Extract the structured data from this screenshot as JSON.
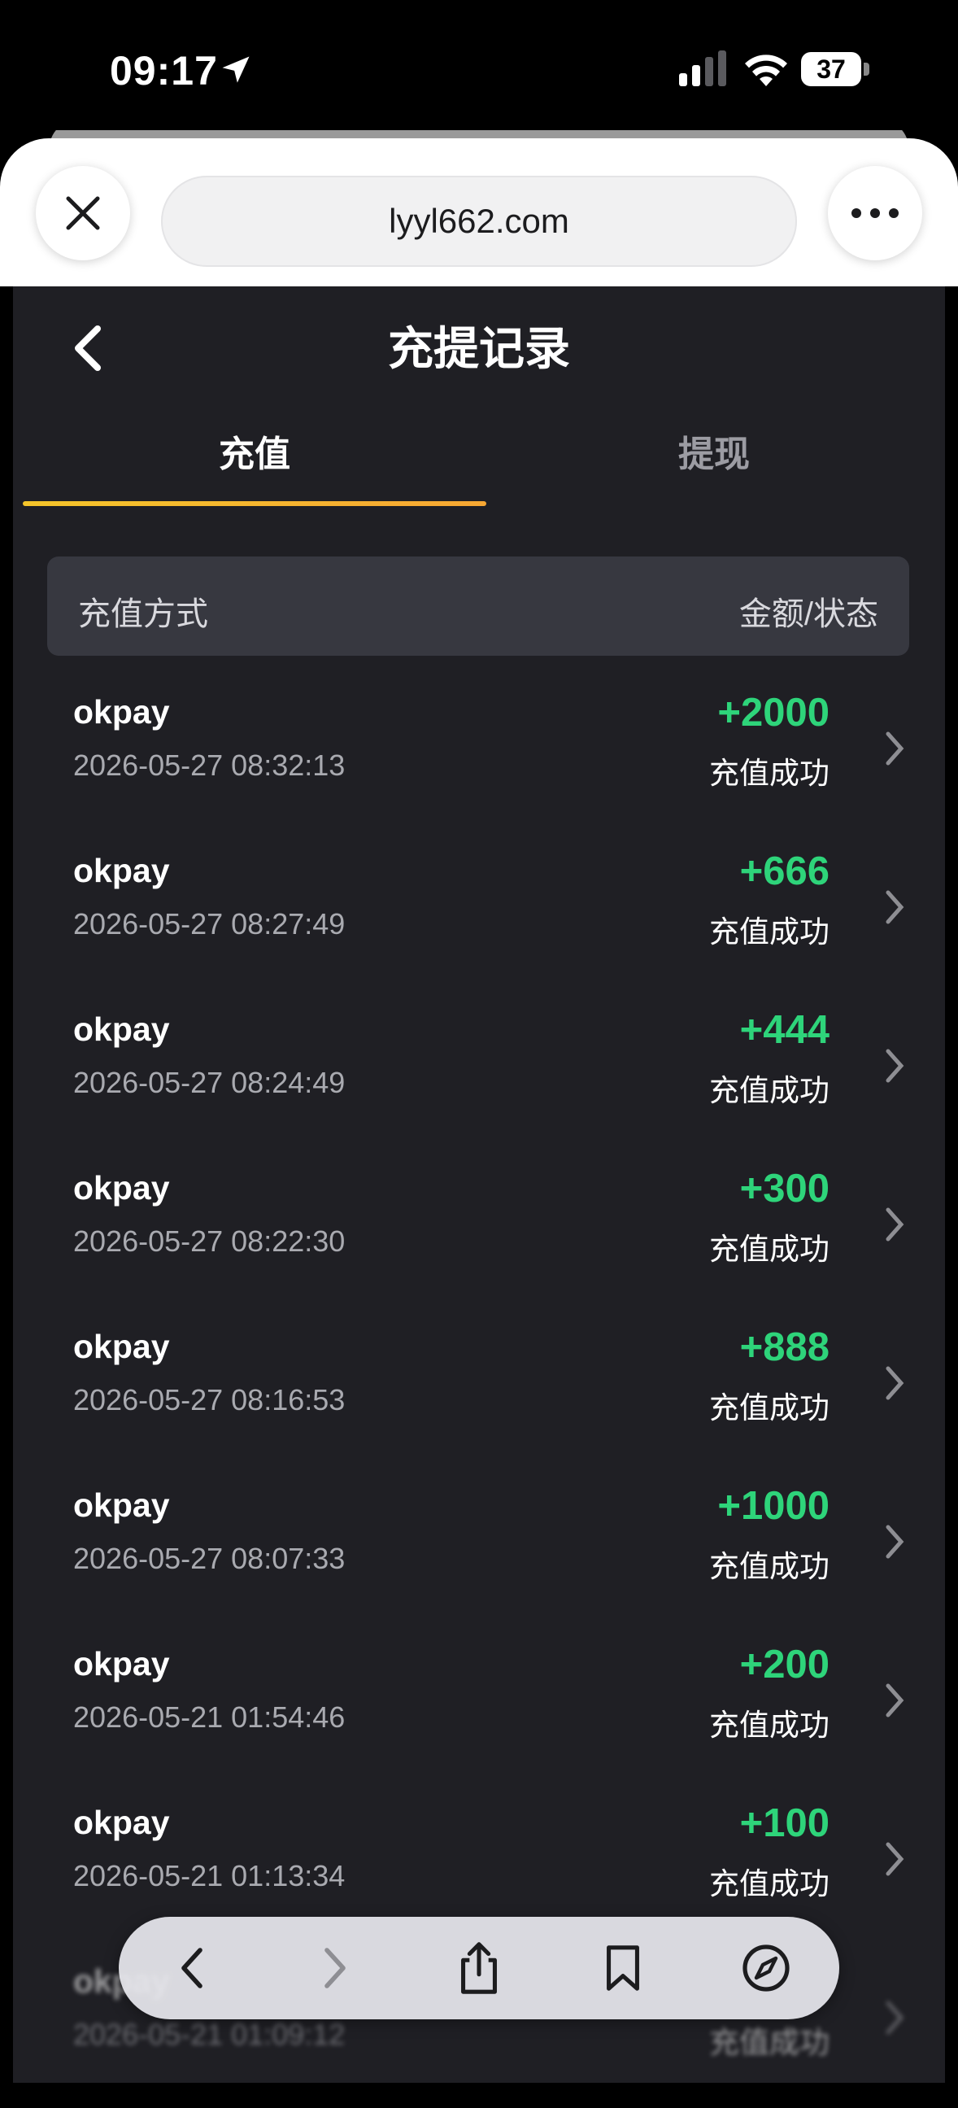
{
  "status_bar": {
    "time": "09:17",
    "battery": "37"
  },
  "browser": {
    "url": "lyyl662.com"
  },
  "page": {
    "title": "充提记录"
  },
  "tabs": [
    {
      "label": "充值",
      "active": true
    },
    {
      "label": "提现",
      "active": false
    }
  ],
  "list_header": {
    "left": "充值方式",
    "right": "金额/状态"
  },
  "records": [
    {
      "method": "okpay",
      "date": "2026-05-27 08:32:13",
      "amount": "+2000",
      "status": "充值成功"
    },
    {
      "method": "okpay",
      "date": "2026-05-27 08:27:49",
      "amount": "+666",
      "status": "充值成功"
    },
    {
      "method": "okpay",
      "date": "2026-05-27 08:24:49",
      "amount": "+444",
      "status": "充值成功"
    },
    {
      "method": "okpay",
      "date": "2026-05-27 08:22:30",
      "amount": "+300",
      "status": "充值成功"
    },
    {
      "method": "okpay",
      "date": "2026-05-27 08:16:53",
      "amount": "+888",
      "status": "充值成功"
    },
    {
      "method": "okpay",
      "date": "2026-05-27 08:07:33",
      "amount": "+1000",
      "status": "充值成功"
    },
    {
      "method": "okpay",
      "date": "2026-05-21 01:54:46",
      "amount": "+200",
      "status": "充值成功"
    },
    {
      "method": "okpay",
      "date": "2026-05-21 01:13:34",
      "amount": "+100",
      "status": "充值成功"
    },
    {
      "method": "okpay",
      "date": "2026-05-21 01:09:12",
      "amount": "",
      "status": "充值成功"
    }
  ],
  "colors": {
    "accent": "#f5c52a",
    "amount_green": "#2ed47a",
    "background": "#1f1f24"
  },
  "toolbar_icons": [
    "back-icon",
    "forward-icon",
    "share-icon",
    "bookmarks-icon",
    "compass-icon"
  ]
}
